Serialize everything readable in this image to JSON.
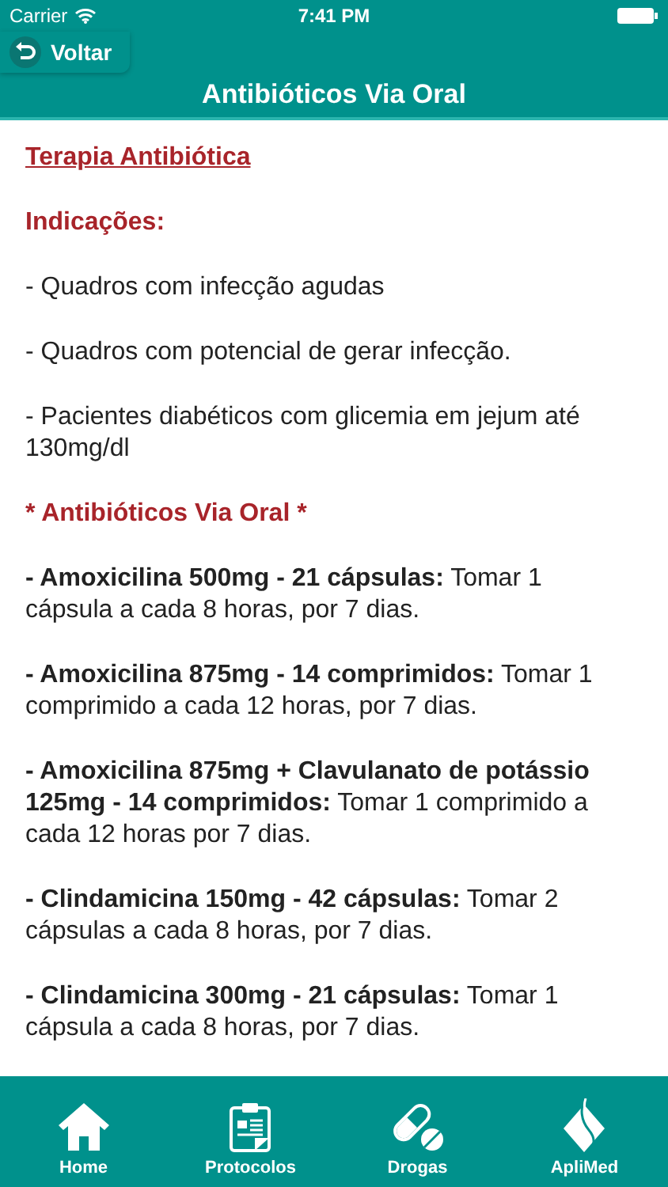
{
  "status_bar": {
    "carrier": "Carrier",
    "time": "7:41 PM"
  },
  "back_button": {
    "label": "Voltar"
  },
  "title": "Antibióticos Via Oral",
  "content": [
    {
      "kind": "title",
      "text": "Terapia Antibiótica"
    },
    {
      "kind": "heading",
      "text": "Indicações:"
    },
    {
      "kind": "text",
      "text": "- Quadros com infecção agudas"
    },
    {
      "kind": "text",
      "text": "- Quadros com potencial de gerar infecção."
    },
    {
      "kind": "text",
      "text": "- Pacientes diabéticos com glicemia em jejum até 130mg/dl"
    },
    {
      "kind": "heading",
      "text": "* Antibióticos Via Oral *"
    },
    {
      "kind": "text",
      "text": "**- Amoxicilina 500mg - 21 cápsulas:** Tomar 1 cápsula a cada 8 horas, por 7 dias."
    },
    {
      "kind": "text",
      "text": "**- Amoxicilina 875mg - 14 comprimidos:** Tomar 1 comprimido a cada 12 horas, por 7 dias."
    },
    {
      "kind": "text",
      "text": "**- Amoxicilina 875mg + Clavulanato de potássio 125mg - 14 comprimidos:** Tomar 1 comprimido a cada 12 horas por 7 dias."
    },
    {
      "kind": "text",
      "text": "**- Clindamicina 150mg - 42 cápsulas:** Tomar 2 cápsulas a cada 8 horas, por 7 dias."
    },
    {
      "kind": "text",
      "text": "**- Clindamicina 300mg - 21 cápsulas:** Tomar 1 cápsula a cada 8 horas, por 7 dias."
    }
  ],
  "tab_bar": [
    {
      "kind": "home",
      "label": "Home"
    },
    {
      "kind": "protocols",
      "label": "Protocolos"
    },
    {
      "kind": "drugs",
      "label": "Drogas"
    },
    {
      "kind": "brand",
      "label": "ApliMed"
    }
  ]
}
